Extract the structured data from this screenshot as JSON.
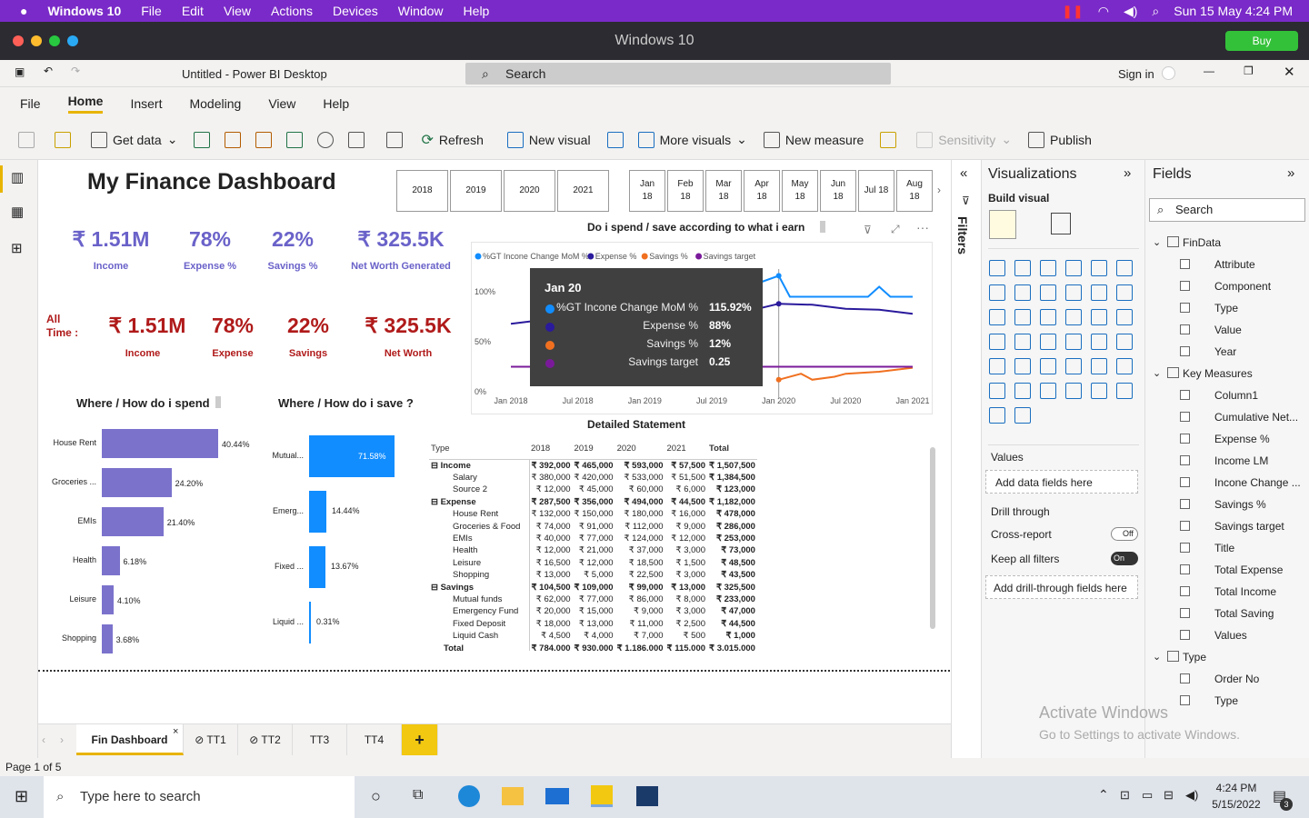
{
  "mac": {
    "app": "Windows 10",
    "menu": [
      "File",
      "Edit",
      "View",
      "Actions",
      "Devices",
      "Window",
      "Help"
    ],
    "clock": "Sun 15 May  4:24 PM"
  },
  "pd": {
    "title": "Windows 10",
    "buy": "Buy"
  },
  "app": {
    "title": "Untitled - Power BI Desktop",
    "search": "Search",
    "signin": "Sign in"
  },
  "ribbon_tabs": [
    "File",
    "Home",
    "Insert",
    "Modeling",
    "View",
    "Help"
  ],
  "ribbon": {
    "get_data": "Get data",
    "refresh": "Refresh",
    "new_visual": "New visual",
    "more_visuals": "More visuals",
    "new_measure": "New measure",
    "sensitivity": "Sensitivity",
    "publish": "Publish"
  },
  "dash": {
    "title": "My Finance Dashboard",
    "years": [
      "2018",
      "2019",
      "2020",
      "2021"
    ],
    "months": [
      [
        "Jan",
        "18"
      ],
      [
        "Feb",
        "18"
      ],
      [
        "Mar",
        "18"
      ],
      [
        "Apr",
        "18"
      ],
      [
        "May",
        "18"
      ],
      [
        "Jun",
        "18"
      ],
      [
        "Jul 18",
        ""
      ],
      [
        "Aug",
        "18"
      ]
    ],
    "kpi": [
      {
        "v": "₹ 1.51M",
        "l": "Income"
      },
      {
        "v": "78%",
        "l": "Expense %"
      },
      {
        "v": "22%",
        "l": "Savings %"
      },
      {
        "v": "₹ 325.5K",
        "l": "Net Worth Generated"
      }
    ],
    "alltime_label": "All Time :",
    "alltime": [
      {
        "v": "₹ 1.51M",
        "l": "Income"
      },
      {
        "v": "78%",
        "l": "Expense"
      },
      {
        "v": "22%",
        "l": "Savings"
      },
      {
        "v": "₹ 325.5K",
        "l": "Net Worth"
      }
    ],
    "spend_title": "Where / How do i spend",
    "save_title": "Where / How do i save ?",
    "line_title": "Do i spend / save according to what i earn",
    "table_title": "Detailed Statement"
  },
  "tooltip": {
    "date": "Jan 20",
    "rows": [
      [
        "%GT Incone Change MoM %",
        "115.92%"
      ],
      [
        "Expense %",
        "88%"
      ],
      [
        "Savings %",
        "12%"
      ],
      [
        "Savings target",
        "0.25"
      ]
    ]
  },
  "chart_data": [
    {
      "type": "bar",
      "title": "Where / How do i spend",
      "categories": [
        "House Rent",
        "Groceries ...",
        "EMIs",
        "Health",
        "Leisure",
        "Shopping"
      ],
      "values": [
        40.44,
        24.2,
        21.4,
        6.18,
        4.1,
        3.68
      ],
      "labels": [
        "40.44%",
        "24.20%",
        "21.40%",
        "6.18%",
        "4.10%",
        "3.68%"
      ],
      "color": "#7b72cc"
    },
    {
      "type": "bar",
      "title": "Where / How do i save ?",
      "categories": [
        "Mutual...",
        "Emerg...",
        "Fixed ...",
        "Liquid ..."
      ],
      "values": [
        71.58,
        14.44,
        13.67,
        0.31
      ],
      "labels": [
        "71.58%",
        "14.44%",
        "13.67%",
        "0.31%"
      ],
      "color": "#118dff"
    },
    {
      "type": "line",
      "title": "Do i spend / save according to what i earn",
      "legend": [
        "%GT Incone Change MoM %",
        "Expense %",
        "Savings %",
        "Savings target"
      ],
      "colors": [
        "#118dff",
        "#2a1a9c",
        "#f07020",
        "#7a1a9a"
      ],
      "x_ticks": [
        "Jan 2018",
        "Jul 2018",
        "Jan 2019",
        "Jul 2019",
        "Jan 2020",
        "Jul 2020",
        "Jan 2021"
      ],
      "y_ticks": [
        "100%",
        "50%",
        "0%"
      ],
      "series": [
        {
          "name": "%GT Incone Change MoM %",
          "x": [
            "2019-06",
            "2019-09",
            "2020-01",
            "2020-02",
            "2020-05",
            "2020-09",
            "2020-10",
            "2020-11",
            "2021-01"
          ],
          "y": [
            0.95,
            1.0,
            1.16,
            0.95,
            0.95,
            0.95,
            1.05,
            0.95,
            0.95
          ]
        },
        {
          "name": "Expense %",
          "x": [
            "2018-01",
            "2018-04",
            "2018-07",
            "2018-10",
            "2019-01",
            "2019-04",
            "2019-07",
            "2019-10",
            "2020-01",
            "2020-04",
            "2020-07",
            "2020-10",
            "2021-01"
          ],
          "y": [
            0.68,
            0.72,
            0.65,
            0.7,
            0.75,
            0.7,
            0.72,
            0.8,
            0.88,
            0.87,
            0.83,
            0.82,
            0.78
          ]
        },
        {
          "name": "Savings %",
          "x": [
            "2020-01",
            "2020-03",
            "2020-04",
            "2020-06",
            "2020-07",
            "2020-10",
            "2021-01"
          ],
          "y": [
            0.12,
            0.18,
            0.12,
            0.15,
            0.18,
            0.2,
            0.24
          ]
        },
        {
          "name": "Savings target",
          "x": [
            "2018-01",
            "2021-01"
          ],
          "y": [
            0.25,
            0.25
          ]
        }
      ]
    }
  ],
  "statement": {
    "headers": [
      "Type",
      "2018",
      "2019",
      "2020",
      "2021",
      "Total"
    ],
    "rows": [
      [
        "Income",
        "₹ 392,000",
        "₹ 465,000",
        "₹ 593,000",
        "₹ 57,500",
        "₹ 1,507,500"
      ],
      [
        "Salary",
        "₹ 380,000",
        "₹ 420,000",
        "₹ 533,000",
        "₹ 51,500",
        "₹ 1,384,500"
      ],
      [
        "Source 2",
        "₹ 12,000",
        "₹ 45,000",
        "₹ 60,000",
        "₹ 6,000",
        "₹ 123,000"
      ],
      [
        "Expense",
        "₹ 287,500",
        "₹ 356,000",
        "₹ 494,000",
        "₹ 44,500",
        "₹ 1,182,000"
      ],
      [
        "House Rent",
        "₹ 132,000",
        "₹ 150,000",
        "₹ 180,000",
        "₹ 16,000",
        "₹ 478,000"
      ],
      [
        "Groceries & Food",
        "₹ 74,000",
        "₹ 91,000",
        "₹ 112,000",
        "₹ 9,000",
        "₹ 286,000"
      ],
      [
        "EMIs",
        "₹ 40,000",
        "₹ 77,000",
        "₹ 124,000",
        "₹ 12,000",
        "₹ 253,000"
      ],
      [
        "Health",
        "₹ 12,000",
        "₹ 21,000",
        "₹ 37,000",
        "₹ 3,000",
        "₹ 73,000"
      ],
      [
        "Leisure",
        "₹ 16,500",
        "₹ 12,000",
        "₹ 18,500",
        "₹ 1,500",
        "₹ 48,500"
      ],
      [
        "Shopping",
        "₹ 13,000",
        "₹ 5,000",
        "₹ 22,500",
        "₹ 3,000",
        "₹ 43,500"
      ],
      [
        "Savings",
        "₹ 104,500",
        "₹ 109,000",
        "₹ 99,000",
        "₹ 13,000",
        "₹ 325,500"
      ],
      [
        "Mutual funds",
        "₹ 62,000",
        "₹ 77,000",
        "₹ 86,000",
        "₹ 8,000",
        "₹ 233,000"
      ],
      [
        "Emergency Fund",
        "₹ 20,000",
        "₹ 15,000",
        "₹ 9,000",
        "₹ 3,000",
        "₹ 47,000"
      ],
      [
        "Fixed Deposit",
        "₹ 18,000",
        "₹ 13,000",
        "₹ 11,000",
        "₹ 2,500",
        "₹ 44,500"
      ],
      [
        "Liquid Cash",
        "₹ 4,500",
        "₹ 4,000",
        "₹ 7,000",
        "₹ 500",
        "₹ 1,000"
      ],
      [
        "Total",
        "₹ 784,000",
        "₹ 930,000",
        "₹ 1,186,000",
        "₹ 115,000",
        "₹ 3,015,000"
      ]
    ]
  },
  "viz": {
    "title": "Visualizations",
    "build": "Build visual",
    "values": "Values",
    "add_data": "Add data fields here",
    "drill": "Drill through",
    "cross": "Cross-report",
    "cross_state": "Off",
    "keep": "Keep all filters",
    "keep_state": "On",
    "add_drill": "Add drill-through fields here"
  },
  "filters_label": "Filters",
  "fields": {
    "title": "Fields",
    "search": "Search",
    "items": [
      "FinData",
      "Attribute",
      "Component",
      "Type",
      "Value",
      "Year",
      "Key Measures",
      "Column1",
      "Cumulative Net...",
      "Expense %",
      "Income LM",
      "Incone Change ...",
      "Savings %",
      "Savings target",
      "Title",
      "Total Expense",
      "Total Income",
      "Total Saving",
      "Values",
      "Type",
      "Order No",
      "Type"
    ]
  },
  "watermark": {
    "l1": "Activate Windows",
    "l2": "Go to Settings to activate Windows."
  },
  "pages": [
    "Fin Dashboard",
    "TT1",
    "TT2",
    "TT3",
    "TT4"
  ],
  "status": "Page 1 of 5",
  "taskbar": {
    "search": "Type here to search",
    "time": "4:24 PM",
    "date": "5/15/2022",
    "badge": "3"
  }
}
